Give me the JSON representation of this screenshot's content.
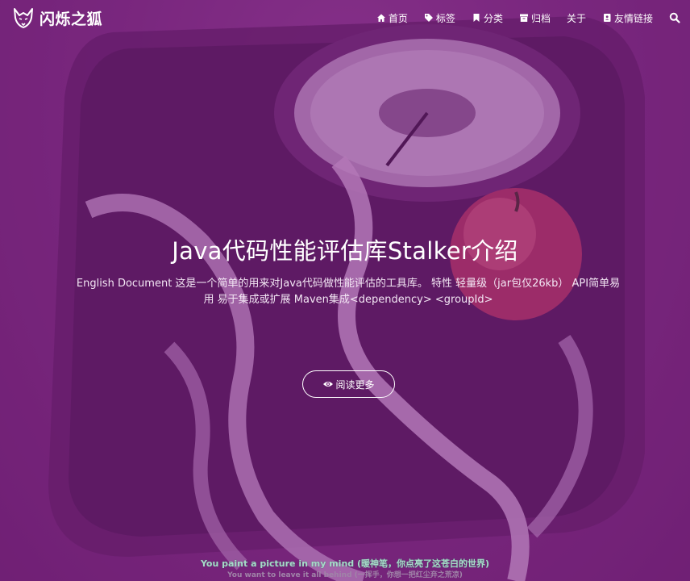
{
  "brand": {
    "name": "闪烁之狐",
    "logo_icon": "fox-icon"
  },
  "nav": {
    "items": [
      {
        "label": "首页",
        "icon": "home-icon"
      },
      {
        "label": "标签",
        "icon": "tags-icon"
      },
      {
        "label": "分类",
        "icon": "bookmark-icon"
      },
      {
        "label": "归档",
        "icon": "archive-icon"
      },
      {
        "label": "关于",
        "icon": ""
      },
      {
        "label": "友情链接",
        "icon": "address-book-icon"
      }
    ],
    "search_icon": "search-icon"
  },
  "hero": {
    "title": "Java代码性能评估库Stalker介绍",
    "summary": "English Document 这是一个简单的用来对Java代码做性能评估的工具库。 特性 轻量级（jar包仅26kb） API简单易用 易于集成或扩展 Maven集成<dependency> <groupId>",
    "read_more": "阅读更多",
    "read_more_icon": "eye-icon"
  },
  "music": {
    "lyric_main": "You paint a picture in my mind (暖神笔，你点亮了这苍白的世界)",
    "lyric_sub": "You want to leave it all behind (一挥手，你想一把红尘弃之荒凉)"
  },
  "colors": {
    "overlay": "#7a2a7e",
    "lyric_main": "#a8d9c9",
    "lyric_sub": "#a084a8",
    "text": "#ffffff"
  }
}
